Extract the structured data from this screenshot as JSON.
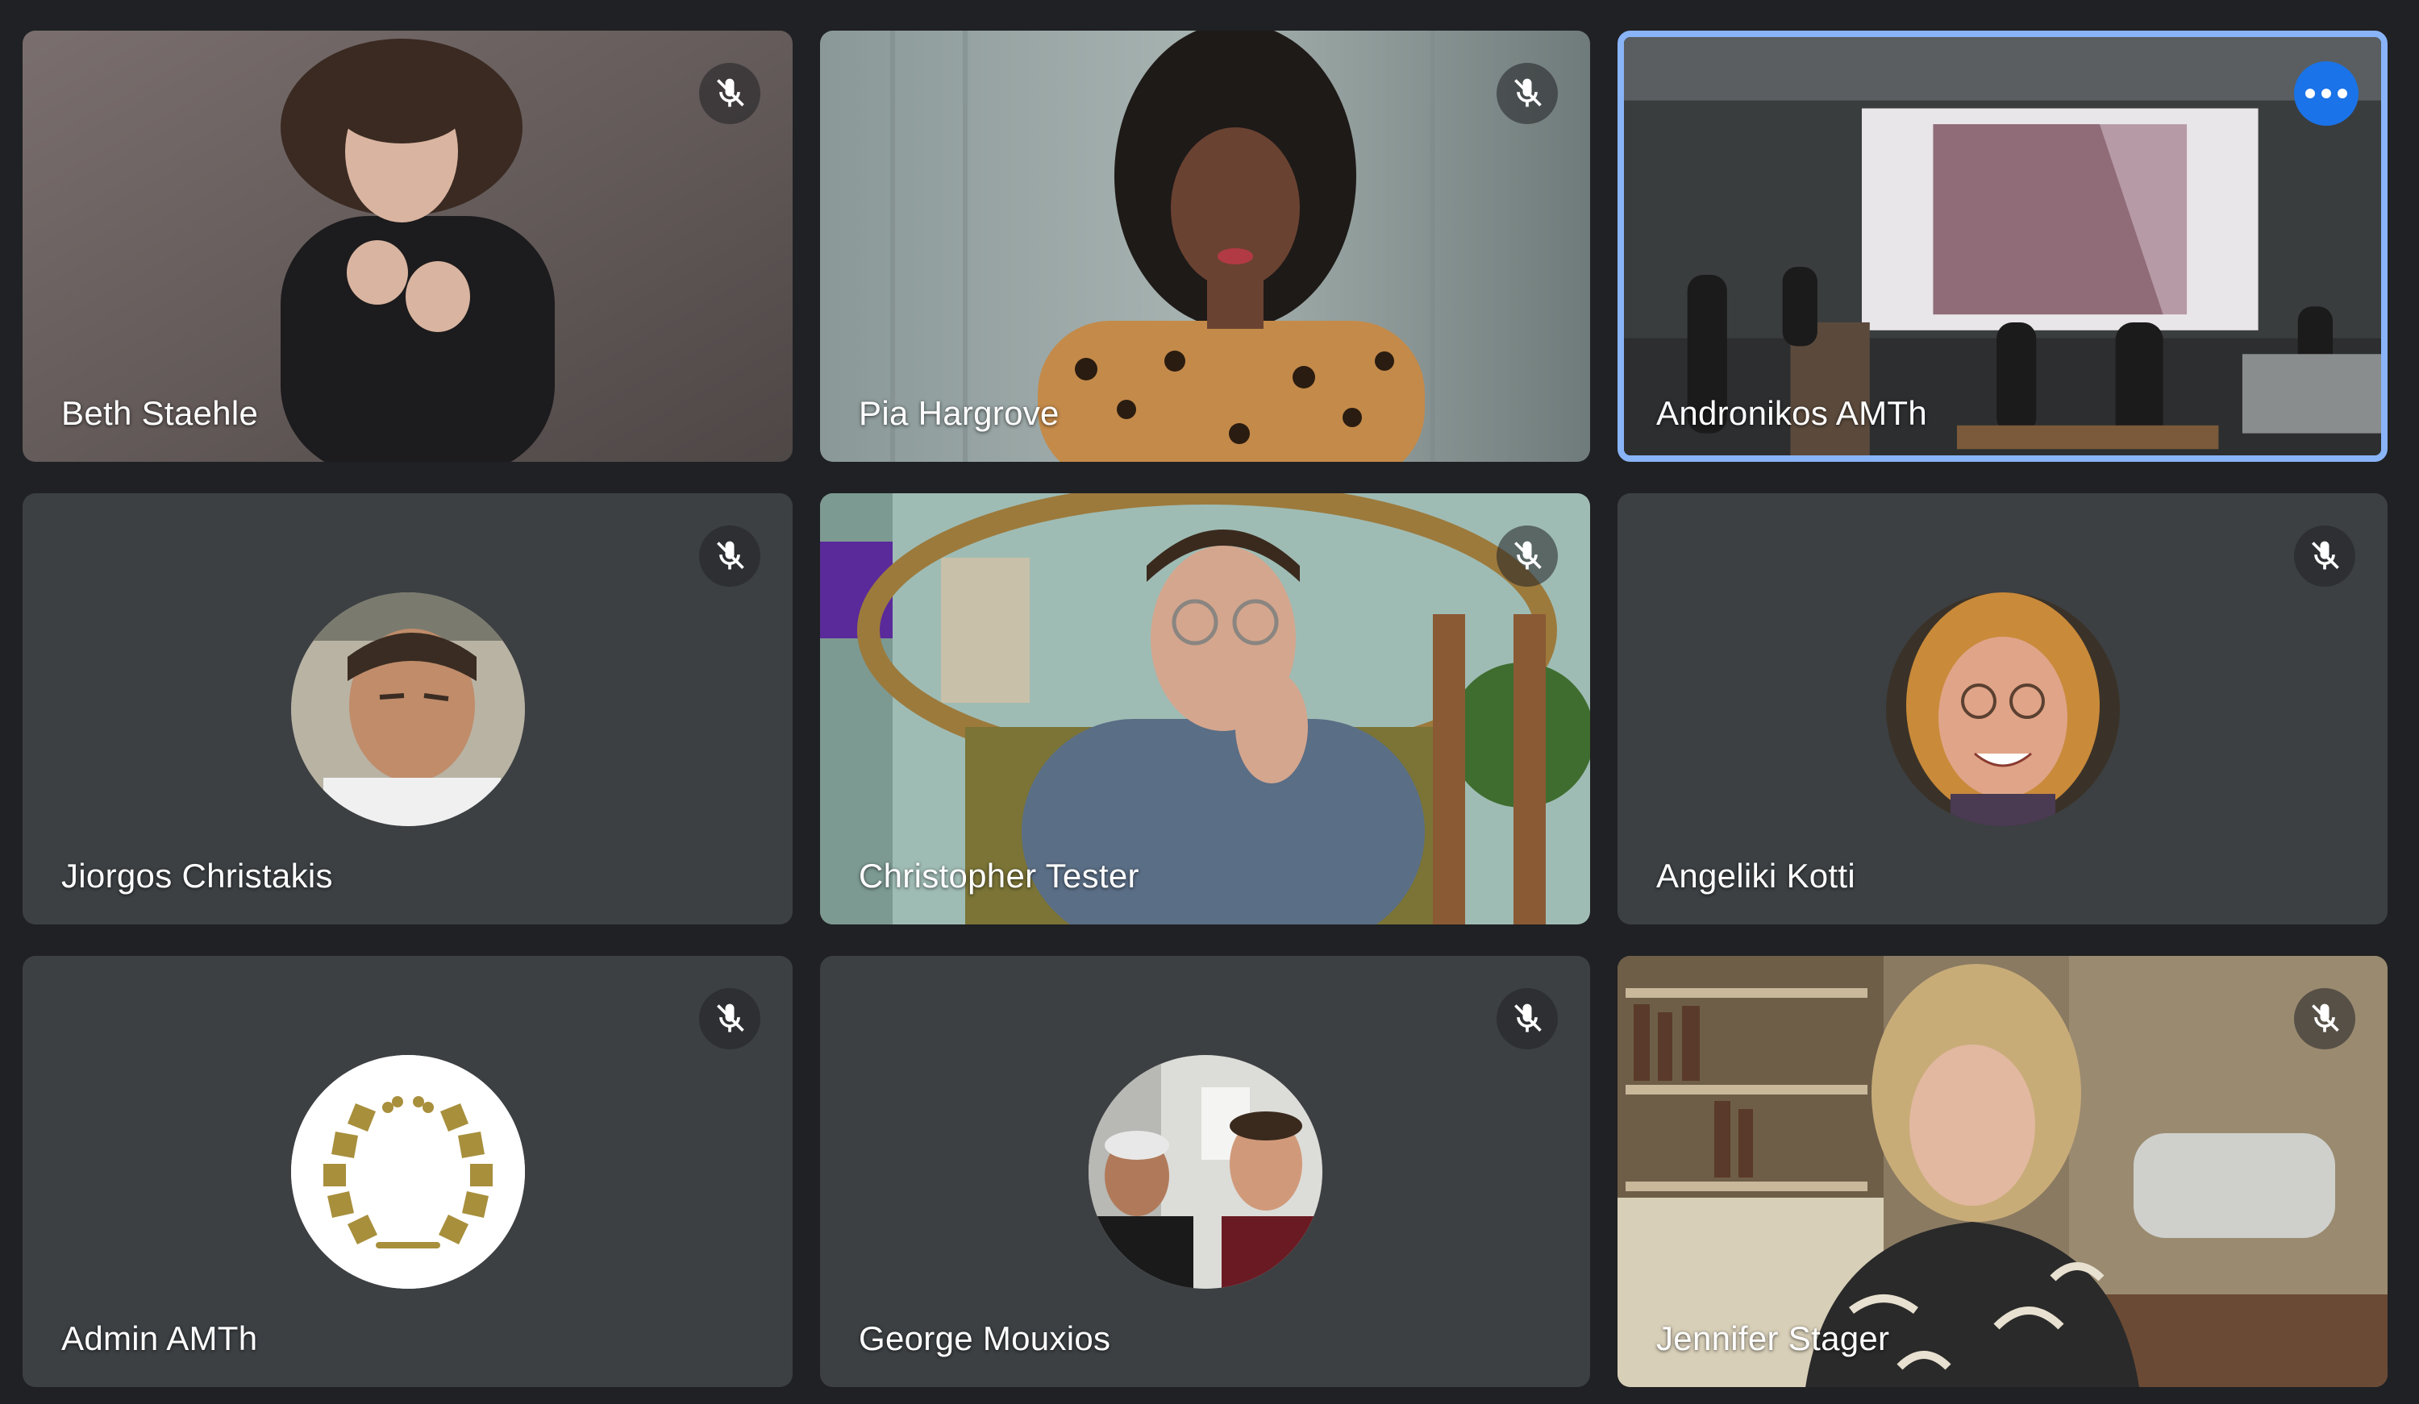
{
  "meeting": {
    "participants": [
      {
        "id": "p1",
        "name": "Beth Staehle",
        "muted": true
      },
      {
        "id": "p2",
        "name": "Pia Hargrove",
        "muted": true
      },
      {
        "id": "p3",
        "name": "Andronikos AMTh",
        "active_speaker": true
      },
      {
        "id": "p4",
        "name": "Jiorgos Christakis",
        "muted": true
      },
      {
        "id": "p5",
        "name": "Christopher Tester",
        "muted": true
      },
      {
        "id": "p6",
        "name": "Angeliki Kotti",
        "muted": true
      },
      {
        "id": "p7",
        "name": "Admin AMTh",
        "muted": true
      },
      {
        "id": "p8",
        "name": "George Mouxios",
        "muted": true
      },
      {
        "id": "p9",
        "name": "Jennifer Stager",
        "muted": true
      }
    ]
  },
  "colors": {
    "background": "#202124",
    "tile": "#3c4043",
    "active_border": "#8ab4f8",
    "more_button": "#1a73e8",
    "laurel_gold": "#a88f3c"
  },
  "icons": {
    "mute": "mic-off-icon",
    "more": "more-options-icon"
  }
}
